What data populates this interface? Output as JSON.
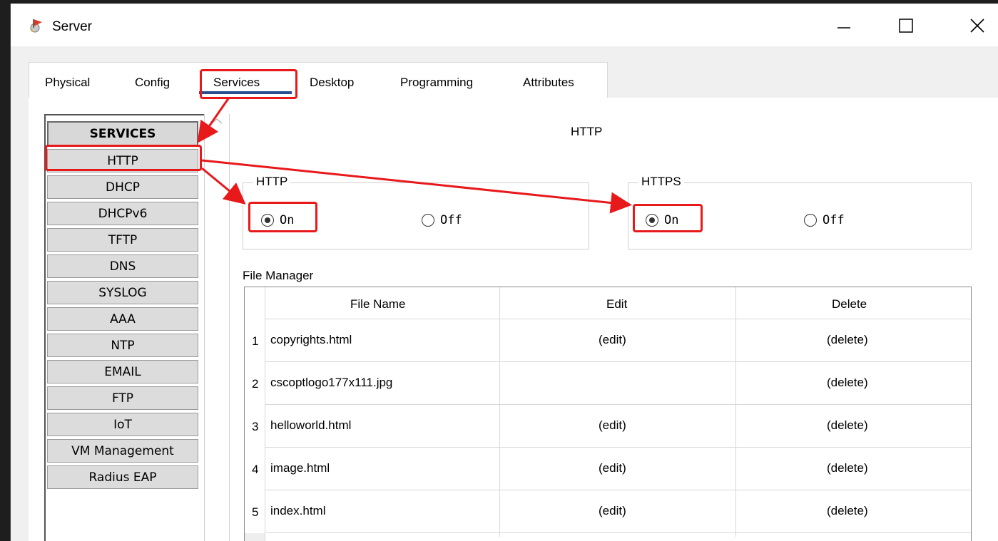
{
  "window": {
    "title": "Server"
  },
  "tabs": [
    "Physical",
    "Config",
    "Services",
    "Desktop",
    "Programming",
    "Attributes"
  ],
  "services": {
    "header": "SERVICES",
    "items": [
      "HTTP",
      "DHCP",
      "DHCPv6",
      "TFTP",
      "DNS",
      "SYSLOG",
      "AAA",
      "NTP",
      "EMAIL",
      "FTP",
      "IoT",
      "VM Management",
      "Radius EAP"
    ]
  },
  "content": {
    "title": "HTTP",
    "http_group": {
      "legend": "HTTP",
      "on_label": "On",
      "off_label": "Off",
      "selected": "On"
    },
    "https_group": {
      "legend": "HTTPS",
      "on_label": "On",
      "off_label": "Off",
      "selected": "On"
    },
    "file_manager": {
      "label": "File Manager",
      "columns": [
        "File Name",
        "Edit",
        "Delete"
      ],
      "rows": [
        {
          "num": "1",
          "name": "copyrights.html",
          "edit": "(edit)",
          "delete": "(delete)"
        },
        {
          "num": "2",
          "name": "cscoptlogo177x111.jpg",
          "edit": "",
          "delete": "(delete)"
        },
        {
          "num": "3",
          "name": "helloworld.html",
          "edit": "(edit)",
          "delete": "(delete)"
        },
        {
          "num": "4",
          "name": "image.html",
          "edit": "(edit)",
          "delete": "(delete)"
        },
        {
          "num": "5",
          "name": "index.html",
          "edit": "(edit)",
          "delete": "(delete)"
        }
      ]
    }
  },
  "annotation_color": "#e8191b",
  "icons": [
    "server-app-icon",
    "minimize-icon",
    "maximize-icon",
    "close-icon",
    "scroll-up-icon"
  ]
}
